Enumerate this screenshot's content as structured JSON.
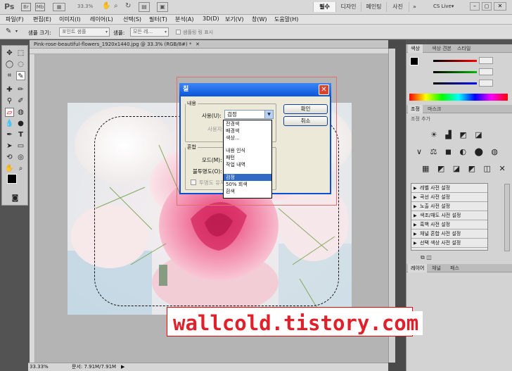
{
  "appbar": {
    "logo": "Ps",
    "zoom": "33.3%",
    "workspaces": [
      "필수",
      "디자인",
      "페인팅",
      "사진"
    ],
    "more": "»",
    "cs_live": "CS Live▾"
  },
  "menu": [
    "파일(F)",
    "편집(E)",
    "이미지(I)",
    "레이어(L)",
    "선택(S)",
    "필터(T)",
    "분석(A)",
    "3D(D)",
    "보기(V)",
    "창(W)",
    "도움말(H)"
  ],
  "options": {
    "sample_size_label": "샘플 크기:",
    "sample_size_value": "포인트 샘플",
    "sample_label": "샘플:",
    "sample_value": "모든 레...",
    "ring_label": "샘플링 링 표시"
  },
  "document": {
    "tab_title": "Pink-rose-beautiful-flowers_1920x1440.jpg @ 33.3% (RGB/8#) *",
    "status_zoom": "33.33%",
    "status_doc": "문서: 7.91M/7.91M"
  },
  "dialog": {
    "title": "칠",
    "contents_legend": "내용",
    "use_label": "사용(U):",
    "use_value": "검정",
    "custom_label": "사용자",
    "blend_legend": "혼합",
    "mode_label": "모드(M):",
    "opacity_label": "불투명도(O):",
    "preserve_label": "투명도 유지",
    "ok_label": "확인",
    "cancel_label": "취소",
    "dropdown_items": [
      "전경색",
      "배경색",
      "색상...",
      "내용 인식",
      "패턴",
      "작업 내역",
      "검정",
      "50% 회색",
      "흰색"
    ],
    "dropdown_selected": "검정"
  },
  "panels": {
    "color_tabs": [
      "색상",
      "색상 견본",
      "스타일"
    ],
    "adjust_tabs": [
      "조정",
      "마스크"
    ],
    "adjust_title": "조정 추가",
    "adjust_presets": [
      "레벨 사전 설정",
      "곡선 사전 설정",
      "노출 사전 설정",
      "색조/채도 사전 설정",
      "흑백 사전 설정",
      "채널 혼합 사전 설정",
      "선택 색상 사전 설정"
    ],
    "layers_tabs": [
      "레이어",
      "채널",
      "패스"
    ],
    "colors": {
      "foreground": "#000000",
      "background": "#ffffff",
      "accent": "#316ac5"
    }
  },
  "watermark": "wallcold.tistory.com"
}
